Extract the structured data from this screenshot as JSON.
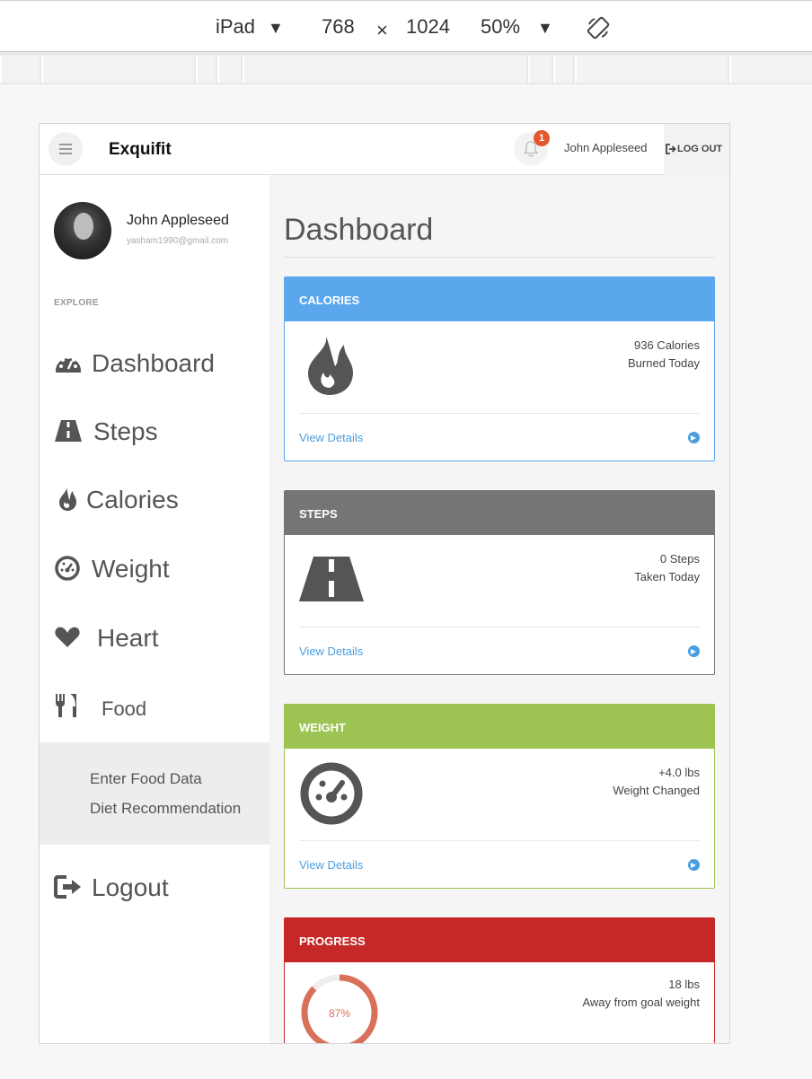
{
  "devtools": {
    "device": "iPad",
    "device_arrow": "▼",
    "width": "768",
    "times": "×",
    "height": "1024",
    "zoom": "50%",
    "zoom_arrow": "▼"
  },
  "navbar": {
    "brand": "Exquifit",
    "notification_count": "1",
    "user_name": "John Appleseed",
    "logout_label": "LOG OUT"
  },
  "sidebar": {
    "profile_name": "John Appleseed",
    "profile_email": "yasham1990@gmail.com",
    "section_label": "EXPLORE",
    "items": [
      {
        "label": "Dashboard",
        "icon": "dashboard-icon"
      },
      {
        "label": "Steps",
        "icon": "road-icon"
      },
      {
        "label": "Calories",
        "icon": "fire-icon"
      },
      {
        "label": "Weight",
        "icon": "gauge-icon"
      },
      {
        "label": "Heart",
        "icon": "heart-icon"
      },
      {
        "label": "Food",
        "icon": "cutlery-icon"
      }
    ],
    "subitems": [
      "Enter Food Data",
      "Diet Recommendation"
    ],
    "logout_label": "Logout"
  },
  "main": {
    "title": "Dashboard",
    "cards": [
      {
        "header": "CALORIES",
        "line1": "936 Calories",
        "line2": "Burned Today",
        "link": "View Details",
        "color": "#5aa7ee",
        "icon": "fire-icon"
      },
      {
        "header": "STEPS",
        "line1": "0 Steps",
        "line2": "Taken Today",
        "link": "View Details",
        "color": "#757575",
        "icon": "road-icon"
      },
      {
        "header": "WEIGHT",
        "line1": "+4.0 lbs",
        "line2": "Weight Changed",
        "link": "View Details",
        "color": "#9dc352",
        "icon": "gauge-icon"
      },
      {
        "header": "PROGRESS",
        "line1": "18 lbs",
        "line2": "Away from goal weight",
        "percent_label": "87%",
        "progress": 0.87,
        "color": "#c62828",
        "ring_color": "#d9705a"
      }
    ]
  },
  "colors": {
    "icon": "#555555",
    "link": "#4a9ee0"
  }
}
